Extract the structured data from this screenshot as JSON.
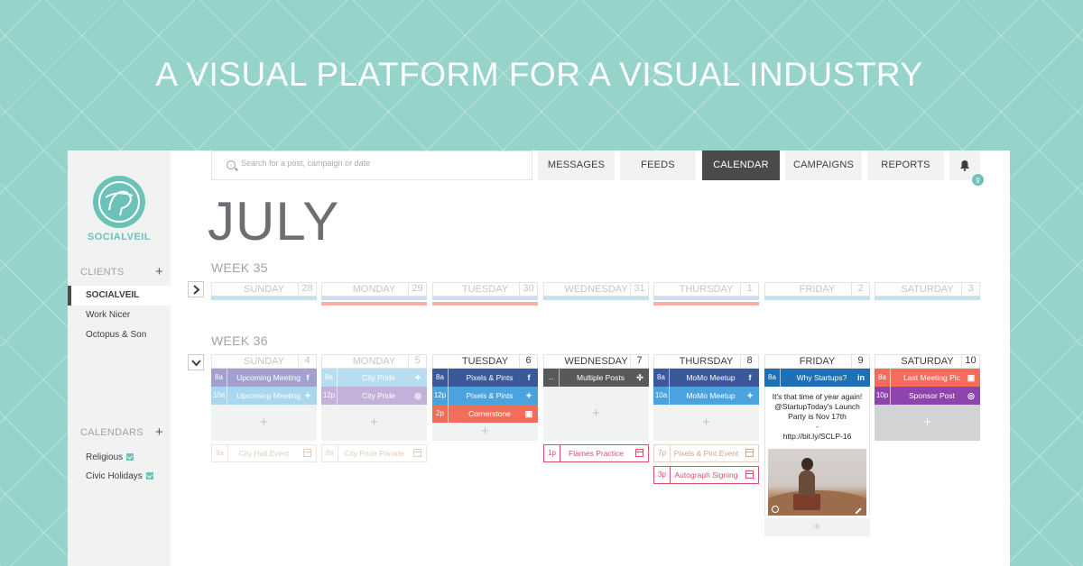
{
  "headline": "A VISUAL PLATFORM FOR A VISUAL INDUSTRY",
  "colors": {
    "accent": "#6cc1b8",
    "facebook": "#3b5998",
    "twitter": "#4aa3df",
    "instagram": "#f26d5b",
    "linkedin": "#1f6fb5",
    "pink": "#d9506b",
    "purple": "#8e44ad",
    "lavender": "#a3a0cf"
  },
  "sidebar": {
    "brand": "SOCIALVEIL",
    "clients_heading": "CLIENTS",
    "clients_add": "+",
    "clients": [
      "SOCIALVEIL",
      "Work Nicer",
      "Octopus & Son"
    ],
    "calendars_heading": "CALENDARS",
    "calendars_add": "+",
    "calendars": [
      "Religious",
      "Civic Holidays"
    ]
  },
  "topbar": {
    "search_placeholder": "Search for a post, campaign or date",
    "nav": [
      "MESSAGES",
      "FEEDS",
      "CALENDAR",
      "CAMPAIGNS",
      "REPORTS"
    ],
    "active_nav": "CALENDAR",
    "notification_count": "9"
  },
  "month": "JULY",
  "weeks": [
    {
      "label": "WEEK 35",
      "days": [
        {
          "name": "SUNDAY",
          "num": "28"
        },
        {
          "name": "MONDAY",
          "num": "29"
        },
        {
          "name": "TUESDAY",
          "num": "30"
        },
        {
          "name": "WEDNESDAY",
          "num": "31"
        },
        {
          "name": "THURSDAY",
          "num": "1"
        },
        {
          "name": "FRIDAY",
          "num": "2"
        },
        {
          "name": "SATURDAY",
          "num": "3"
        }
      ]
    },
    {
      "label": "WEEK 36",
      "days": [
        {
          "name": "SUNDAY",
          "num": "4",
          "events": [
            {
              "time": "8a",
              "label": "Upcoming Meeting",
              "icon": "facebook-icon"
            },
            {
              "time": "10a",
              "label": "Upcoming Meeting",
              "icon": "twitter-icon"
            }
          ],
          "calendar_event": {
            "time": "9a",
            "label": "City Hall Event"
          }
        },
        {
          "name": "MONDAY",
          "num": "5",
          "events": [
            {
              "time": "8a",
              "label": "City Pride",
              "icon": "twitter-icon"
            },
            {
              "time": "12p",
              "label": "City Pride",
              "icon": "search-icon"
            }
          ],
          "calendar_event": {
            "time": "8a",
            "label": "City Pride Parade"
          }
        },
        {
          "name": "TUESDAY",
          "num": "6",
          "events": [
            {
              "time": "8a",
              "label": "Pixels & Pints",
              "icon": "facebook-icon"
            },
            {
              "time": "12p",
              "label": "Pixels & Pints",
              "icon": "twitter-icon"
            },
            {
              "time": "2p",
              "label": "Cornerstone",
              "icon": "instagram-icon"
            }
          ]
        },
        {
          "name": "WEDNESDAY",
          "num": "7",
          "events": [
            {
              "time": "...",
              "label": "Multiple Posts",
              "icon": "multiple-icon"
            }
          ],
          "calendar_event": {
            "time": "1p",
            "label": "Flames Practice"
          }
        },
        {
          "name": "THURSDAY",
          "num": "8",
          "events": [
            {
              "time": "8a",
              "label": "MoMo Meetup",
              "icon": "facebook-icon"
            },
            {
              "time": "10a",
              "label": "MoMo Meetup",
              "icon": "twitter-icon"
            }
          ],
          "calendar_events": [
            {
              "time": "7p",
              "label": "Pixels & Pint Event"
            },
            {
              "time": "3p",
              "label": "Autograph Signing"
            }
          ]
        },
        {
          "name": "FRIDAY",
          "num": "9",
          "events": [
            {
              "time": "8a",
              "label": "Why Startups?",
              "icon": "linkedin-icon"
            }
          ],
          "post_preview": {
            "line1": "It's that time of year again!",
            "line2": "@StartupToday's Launch",
            "line3": "Party is Nov 17th",
            "line4": "-",
            "line5": "http://bit.ly/SCLP-16"
          }
        },
        {
          "name": "SATURDAY",
          "num": "10",
          "events": [
            {
              "time": "8a",
              "label": "Last Meeting Pic",
              "icon": "instagram-icon"
            },
            {
              "time": "10p",
              "label": "Sponsor Post",
              "icon": "search-icon"
            }
          ]
        }
      ]
    }
  ],
  "add_symbol": "+"
}
